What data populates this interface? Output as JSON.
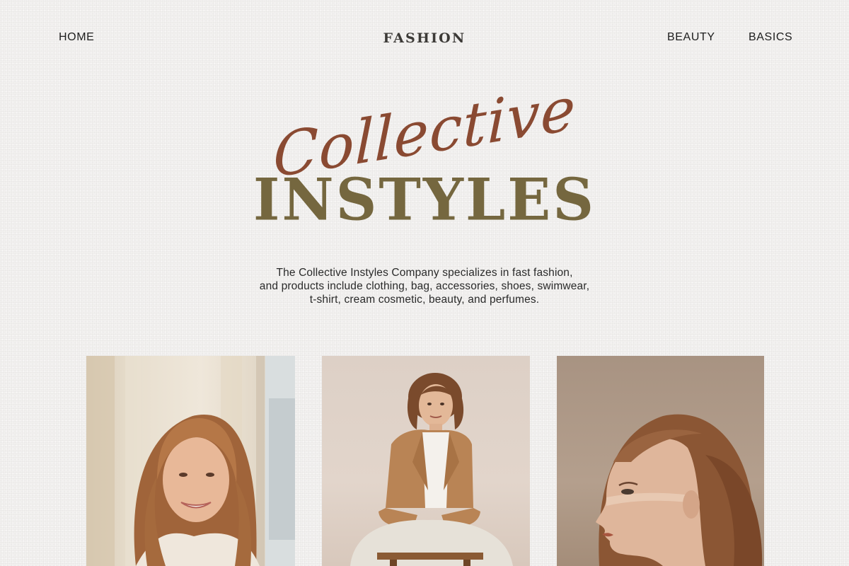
{
  "nav": {
    "home_label": "HOME",
    "brand": "FASHION",
    "beauty_label": "BEAUTY",
    "basics_label": "BASICS"
  },
  "hero": {
    "script_text": "Collective",
    "title": "INSTYLES"
  },
  "description": {
    "line1": "The Collective Instyles Company specializes in fast fashion,",
    "line2": "and products include clothing, bag, accessories, shoes, swimwear,",
    "line3": "t-shirt, cream cosmetic, beauty, and perfumes."
  },
  "colors": {
    "background": "#f2f1ef",
    "script_accent": "#8a4a32",
    "title_olive": "#75673f",
    "text_dark": "#1d1d1d"
  }
}
